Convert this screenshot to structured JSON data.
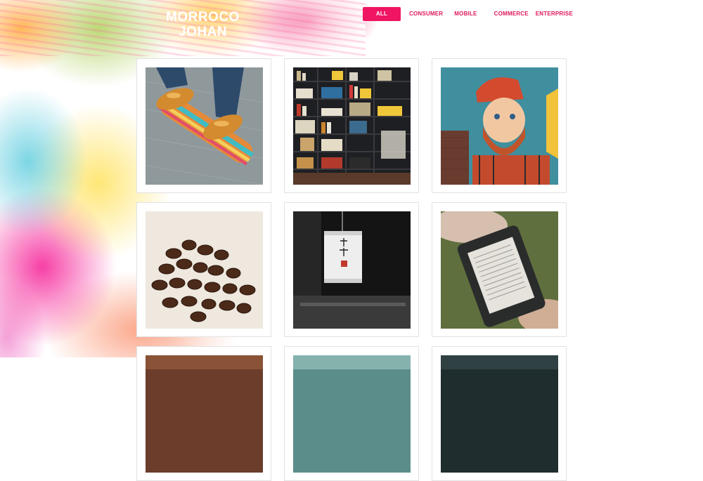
{
  "brand": {
    "line1": "MORROCO",
    "line2": "JOHAN"
  },
  "nav": {
    "items": [
      {
        "label": "ALL",
        "active": true
      },
      {
        "label": "CONSUMER",
        "active": false
      },
      {
        "label": "MOBILE",
        "active": false
      },
      {
        "label": "COMMERCE",
        "active": false
      },
      {
        "label": "ENTERPRISE",
        "active": false
      }
    ]
  },
  "theme": {
    "accent": "#ef1563",
    "nav_text": "#e0195a",
    "card_border": "#e2e2e2"
  },
  "portfolio": {
    "items": [
      {
        "image": "skateboard-shoes-photo"
      },
      {
        "image": "bookshelf-photo"
      },
      {
        "image": "bearded-man-mural-photo"
      },
      {
        "image": "coffee-beans-photo"
      },
      {
        "image": "paper-lantern-photo"
      },
      {
        "image": "ereader-in-hands-photo"
      },
      {
        "image": "partial-photo"
      },
      {
        "image": "partial-photo"
      },
      {
        "image": "partial-photo"
      }
    ]
  }
}
